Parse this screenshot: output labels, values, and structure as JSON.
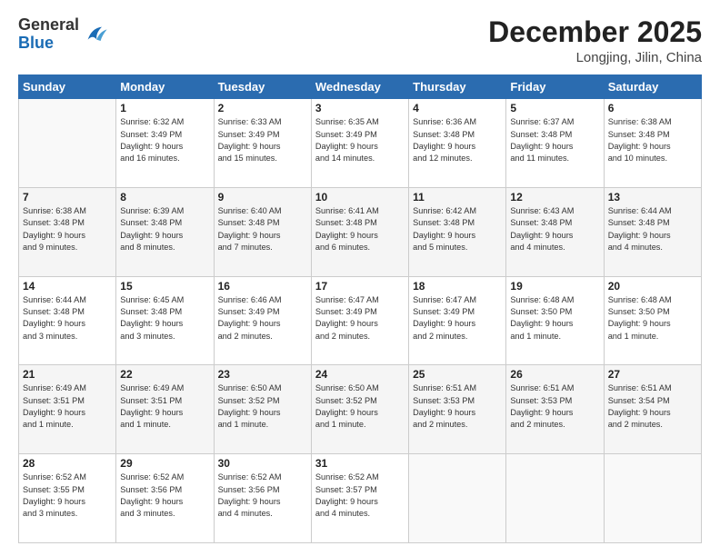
{
  "header": {
    "logo_general": "General",
    "logo_blue": "Blue",
    "month": "December 2025",
    "location": "Longjing, Jilin, China"
  },
  "days_of_week": [
    "Sunday",
    "Monday",
    "Tuesday",
    "Wednesday",
    "Thursday",
    "Friday",
    "Saturday"
  ],
  "weeks": [
    [
      {
        "day": "",
        "info": ""
      },
      {
        "day": "1",
        "info": "Sunrise: 6:32 AM\nSunset: 3:49 PM\nDaylight: 9 hours\nand 16 minutes."
      },
      {
        "day": "2",
        "info": "Sunrise: 6:33 AM\nSunset: 3:49 PM\nDaylight: 9 hours\nand 15 minutes."
      },
      {
        "day": "3",
        "info": "Sunrise: 6:35 AM\nSunset: 3:49 PM\nDaylight: 9 hours\nand 14 minutes."
      },
      {
        "day": "4",
        "info": "Sunrise: 6:36 AM\nSunset: 3:48 PM\nDaylight: 9 hours\nand 12 minutes."
      },
      {
        "day": "5",
        "info": "Sunrise: 6:37 AM\nSunset: 3:48 PM\nDaylight: 9 hours\nand 11 minutes."
      },
      {
        "day": "6",
        "info": "Sunrise: 6:38 AM\nSunset: 3:48 PM\nDaylight: 9 hours\nand 10 minutes."
      }
    ],
    [
      {
        "day": "7",
        "info": "Sunrise: 6:38 AM\nSunset: 3:48 PM\nDaylight: 9 hours\nand 9 minutes."
      },
      {
        "day": "8",
        "info": "Sunrise: 6:39 AM\nSunset: 3:48 PM\nDaylight: 9 hours\nand 8 minutes."
      },
      {
        "day": "9",
        "info": "Sunrise: 6:40 AM\nSunset: 3:48 PM\nDaylight: 9 hours\nand 7 minutes."
      },
      {
        "day": "10",
        "info": "Sunrise: 6:41 AM\nSunset: 3:48 PM\nDaylight: 9 hours\nand 6 minutes."
      },
      {
        "day": "11",
        "info": "Sunrise: 6:42 AM\nSunset: 3:48 PM\nDaylight: 9 hours\nand 5 minutes."
      },
      {
        "day": "12",
        "info": "Sunrise: 6:43 AM\nSunset: 3:48 PM\nDaylight: 9 hours\nand 4 minutes."
      },
      {
        "day": "13",
        "info": "Sunrise: 6:44 AM\nSunset: 3:48 PM\nDaylight: 9 hours\nand 4 minutes."
      }
    ],
    [
      {
        "day": "14",
        "info": "Sunrise: 6:44 AM\nSunset: 3:48 PM\nDaylight: 9 hours\nand 3 minutes."
      },
      {
        "day": "15",
        "info": "Sunrise: 6:45 AM\nSunset: 3:48 PM\nDaylight: 9 hours\nand 3 minutes."
      },
      {
        "day": "16",
        "info": "Sunrise: 6:46 AM\nSunset: 3:49 PM\nDaylight: 9 hours\nand 2 minutes."
      },
      {
        "day": "17",
        "info": "Sunrise: 6:47 AM\nSunset: 3:49 PM\nDaylight: 9 hours\nand 2 minutes."
      },
      {
        "day": "18",
        "info": "Sunrise: 6:47 AM\nSunset: 3:49 PM\nDaylight: 9 hours\nand 2 minutes."
      },
      {
        "day": "19",
        "info": "Sunrise: 6:48 AM\nSunset: 3:50 PM\nDaylight: 9 hours\nand 1 minute."
      },
      {
        "day": "20",
        "info": "Sunrise: 6:48 AM\nSunset: 3:50 PM\nDaylight: 9 hours\nand 1 minute."
      }
    ],
    [
      {
        "day": "21",
        "info": "Sunrise: 6:49 AM\nSunset: 3:51 PM\nDaylight: 9 hours\nand 1 minute."
      },
      {
        "day": "22",
        "info": "Sunrise: 6:49 AM\nSunset: 3:51 PM\nDaylight: 9 hours\nand 1 minute."
      },
      {
        "day": "23",
        "info": "Sunrise: 6:50 AM\nSunset: 3:52 PM\nDaylight: 9 hours\nand 1 minute."
      },
      {
        "day": "24",
        "info": "Sunrise: 6:50 AM\nSunset: 3:52 PM\nDaylight: 9 hours\nand 1 minute."
      },
      {
        "day": "25",
        "info": "Sunrise: 6:51 AM\nSunset: 3:53 PM\nDaylight: 9 hours\nand 2 minutes."
      },
      {
        "day": "26",
        "info": "Sunrise: 6:51 AM\nSunset: 3:53 PM\nDaylight: 9 hours\nand 2 minutes."
      },
      {
        "day": "27",
        "info": "Sunrise: 6:51 AM\nSunset: 3:54 PM\nDaylight: 9 hours\nand 2 minutes."
      }
    ],
    [
      {
        "day": "28",
        "info": "Sunrise: 6:52 AM\nSunset: 3:55 PM\nDaylight: 9 hours\nand 3 minutes."
      },
      {
        "day": "29",
        "info": "Sunrise: 6:52 AM\nSunset: 3:56 PM\nDaylight: 9 hours\nand 3 minutes."
      },
      {
        "day": "30",
        "info": "Sunrise: 6:52 AM\nSunset: 3:56 PM\nDaylight: 9 hours\nand 4 minutes."
      },
      {
        "day": "31",
        "info": "Sunrise: 6:52 AM\nSunset: 3:57 PM\nDaylight: 9 hours\nand 4 minutes."
      },
      {
        "day": "",
        "info": ""
      },
      {
        "day": "",
        "info": ""
      },
      {
        "day": "",
        "info": ""
      }
    ]
  ]
}
